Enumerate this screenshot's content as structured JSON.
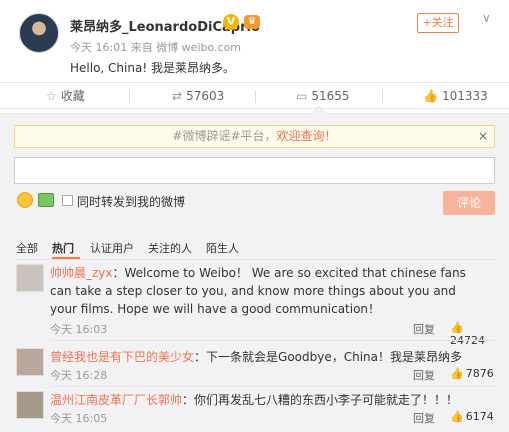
{
  "post": {
    "author": "莱昂纳多_LeonardoDiCaprio",
    "verified_badge": "V",
    "meta": "今天 16:01 来自 微博 weibo.com",
    "text": "Hello, China! 我是莱昂纳多。",
    "follow_label": "+关注",
    "more_icon": "chevron-down-icon"
  },
  "actions": {
    "favorite_label": "收藏",
    "repost_count": "57603",
    "comment_count": "51655",
    "like_count": "101333"
  },
  "comment_box": {
    "notice_prefix": "#微博辟谣#平台，",
    "notice_link": "欢迎查询！",
    "notice_close": "×",
    "input_value": "",
    "repost_checkbox_label": "同时转发到我的微博",
    "submit_label": "评论"
  },
  "tabs": [
    "全部",
    "热门",
    "认证用户",
    "关注的人",
    "陌生人"
  ],
  "comments": [
    {
      "name": "帅帅晨_zyx",
      "text": "：Welcome to Weibo！ We are so excited that chinese fans can take a step closer to you, and know more things about you and your films. Hope we will have a good communication！",
      "time": "今天 16:03",
      "reply": "回复",
      "likes": "24724"
    },
    {
      "name": "曾经我也是有下巴的美少女",
      "text": "：下一条就会是Goodbye，China！我是莱昂纳多",
      "time": "今天 16:28",
      "reply": "回复",
      "likes": "7876"
    },
    {
      "name": "温州江南皮革厂厂长郭帅",
      "text": "：你们再发乱七八糟的东西小李子可能就走了！！！",
      "time": "今天 16:05",
      "reply": "回复",
      "likes": "6174"
    }
  ],
  "colors": {
    "accent": "#eb7350",
    "panel_bg": "#f2f2f5",
    "notice_bg": "#fffbea"
  }
}
